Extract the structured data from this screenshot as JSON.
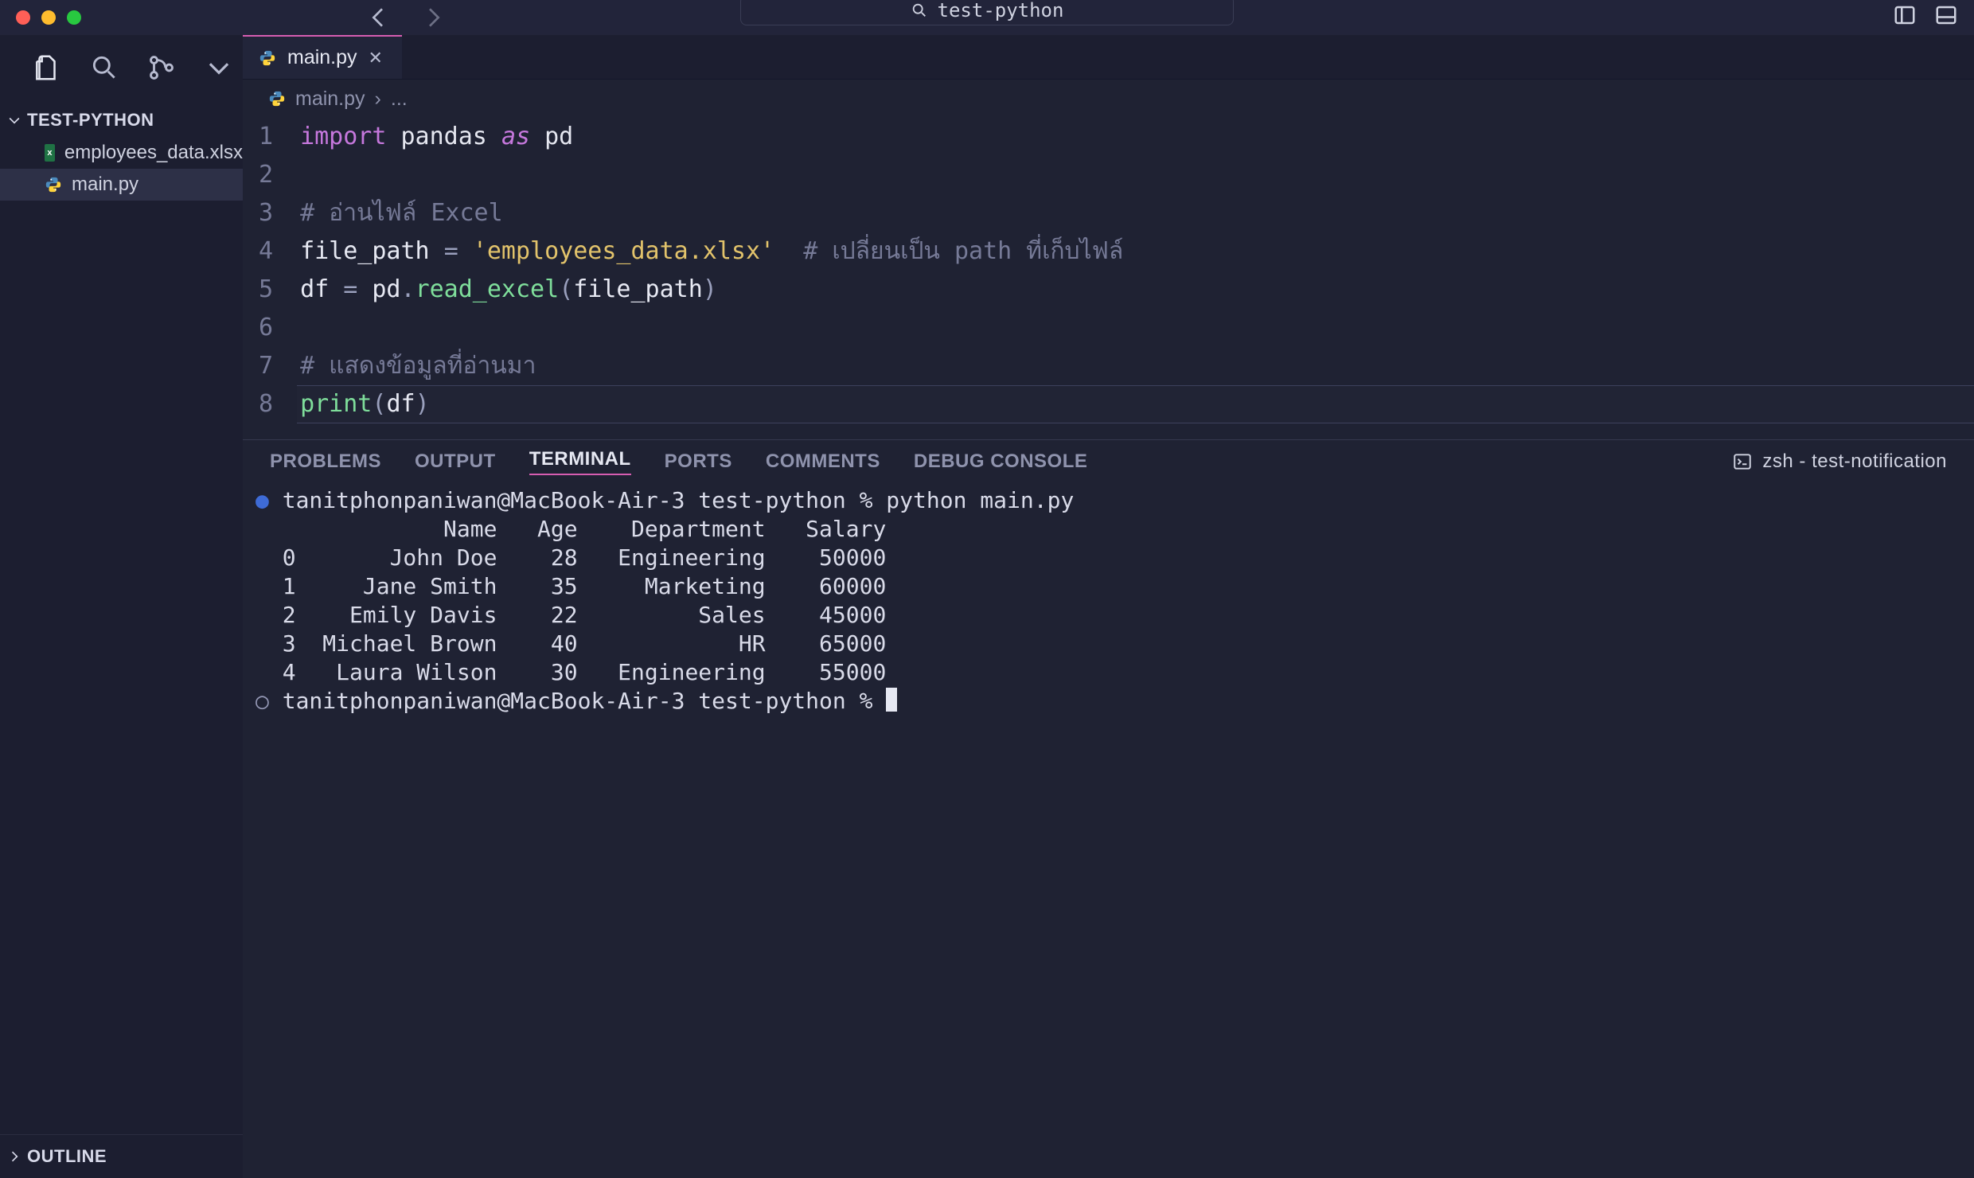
{
  "window": {
    "search_text": "test-python",
    "project_name": "TEST-PYTHON"
  },
  "files": [
    {
      "name": "employees_data.xlsx",
      "icon": "excel",
      "active": false
    },
    {
      "name": "main.py",
      "icon": "python",
      "active": true
    }
  ],
  "tab": {
    "name": "main.py"
  },
  "breadcrumb": {
    "file": "main.py",
    "more": "..."
  },
  "outline_label": "OUTLINE",
  "code_lines": [
    {
      "n": 1,
      "parts": [
        {
          "t": "import",
          "c": "tok-kw"
        },
        {
          "t": " "
        },
        {
          "t": "pandas",
          "c": "tok-mod"
        },
        {
          "t": " "
        },
        {
          "t": "as",
          "c": "tok-kw2"
        },
        {
          "t": " "
        },
        {
          "t": "pd",
          "c": "tok-mod"
        }
      ]
    },
    {
      "n": 2,
      "parts": []
    },
    {
      "n": 3,
      "parts": [
        {
          "t": "# อ่านไฟล์ ",
          "c": "tok-cm"
        },
        {
          "t": "Excel",
          "c": "tok-cm em"
        }
      ]
    },
    {
      "n": 4,
      "parts": [
        {
          "t": "file_path",
          "c": "tok-id"
        },
        {
          "t": " "
        },
        {
          "t": "=",
          "c": "tok-op"
        },
        {
          "t": " "
        },
        {
          "t": "'employees_data.xlsx'",
          "c": "tok-str"
        },
        {
          "t": "  "
        },
        {
          "t": "# เปลี่ยนเป็น ",
          "c": "tok-cm"
        },
        {
          "t": "path",
          "c": "tok-cm em"
        },
        {
          "t": " ที่เก็บไฟล์",
          "c": "tok-cm"
        }
      ]
    },
    {
      "n": 5,
      "parts": [
        {
          "t": "df",
          "c": "tok-id"
        },
        {
          "t": " "
        },
        {
          "t": "=",
          "c": "tok-op"
        },
        {
          "t": " "
        },
        {
          "t": "pd",
          "c": "tok-id"
        },
        {
          "t": ".",
          "c": "tok-op"
        },
        {
          "t": "read_excel",
          "c": "tok-fn"
        },
        {
          "t": "(",
          "c": "tok-op"
        },
        {
          "t": "file_path",
          "c": "tok-id"
        },
        {
          "t": ")",
          "c": "tok-op"
        }
      ]
    },
    {
      "n": 6,
      "parts": []
    },
    {
      "n": 7,
      "parts": [
        {
          "t": "# แสดงข้อมูลที่อ่านมา",
          "c": "tok-cm"
        }
      ]
    },
    {
      "n": 8,
      "hl": true,
      "parts": [
        {
          "t": "print",
          "c": "tok-fn"
        },
        {
          "t": "(",
          "c": "tok-op"
        },
        {
          "t": "df",
          "c": "tok-id"
        },
        {
          "t": ")",
          "c": "tok-op"
        }
      ]
    }
  ],
  "panel": {
    "tabs": [
      "PROBLEMS",
      "OUTPUT",
      "TERMINAL",
      "PORTS",
      "COMMENTS",
      "DEBUG CONSOLE"
    ],
    "active_tab": "TERMINAL",
    "terminal_label": "zsh - test-notification"
  },
  "terminal": {
    "prompt_user": "tanitphonpaniwan@MacBook-Air-3",
    "prompt_dir": "test-python",
    "command": "python main.py",
    "headers": [
      "Name",
      "Age",
      "Department",
      "Salary"
    ],
    "rows": [
      [
        "0",
        "John Doe",
        "28",
        "Engineering",
        "50000"
      ],
      [
        "1",
        "Jane Smith",
        "35",
        "Marketing",
        "60000"
      ],
      [
        "2",
        "Emily Davis",
        "22",
        "Sales",
        "45000"
      ],
      [
        "3",
        "Michael Brown",
        "40",
        "HR",
        "65000"
      ],
      [
        "4",
        "Laura Wilson",
        "30",
        "Engineering",
        "55000"
      ]
    ]
  }
}
